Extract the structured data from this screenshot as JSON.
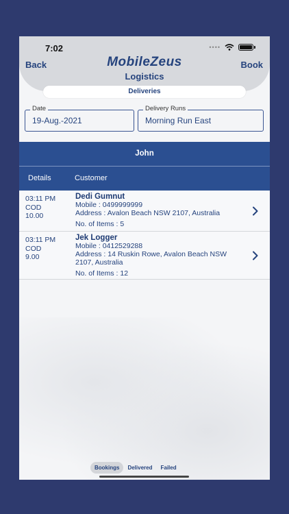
{
  "status_bar": {
    "time": "7:02"
  },
  "nav": {
    "back": "Back",
    "book": "Book"
  },
  "brand": {
    "name": "MobileZeus",
    "sub": "Logistics"
  },
  "segment": {
    "label": "Deliveries"
  },
  "fields": {
    "date": {
      "label": "Date",
      "value": "19-Aug.-2021"
    },
    "runs": {
      "label": "Delivery Runs",
      "value": "Morning Run East"
    }
  },
  "driver": {
    "name": "John"
  },
  "columns": {
    "details": "Details",
    "customer": "Customer"
  },
  "rows": [
    {
      "time": "03:11 PM",
      "type": "COD",
      "amount": "10.00",
      "name": "Dedi Gumnut",
      "mobile_label": "Mobile :",
      "mobile": "0499999999",
      "address_label": "Address :",
      "address": "Avalon Beach NSW 2107, Australia",
      "items_label": "No. of Items :",
      "items": "5"
    },
    {
      "time": "03:11 PM",
      "type": "COD",
      "amount": "9.00",
      "name": "Jek Logger",
      "mobile_label": "Mobile :",
      "mobile": "0412529288",
      "address_label": "Address :",
      "address": "14 Ruskin Rowe, Avalon Beach NSW 2107, Australia",
      "items_label": "No. of Items :",
      "items": "12"
    }
  ],
  "tabs": {
    "bookings": "Bookings",
    "delivered": "Delivered",
    "failed": "Failed"
  },
  "colors": {
    "primary": "#25437d",
    "band": "#2b4f91",
    "frame": "#2e3a6e"
  },
  "icons": [
    "wifi-icon",
    "battery-icon",
    "chevron-right-icon"
  ]
}
